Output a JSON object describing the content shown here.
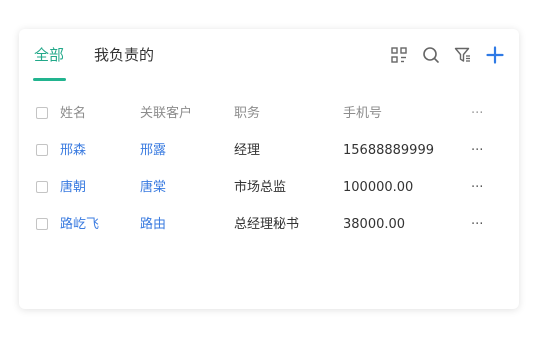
{
  "tabs": [
    {
      "label": "全部",
      "active": true
    },
    {
      "label": "我负责的",
      "active": false
    }
  ],
  "toolbar": {
    "icons": [
      "grid-view-icon",
      "search-icon",
      "filter-icon",
      "add-icon"
    ]
  },
  "colors": {
    "accent": "#22b48f",
    "link": "#3a7be0",
    "add": "#2f7ae5"
  },
  "table": {
    "columns": [
      "姓名",
      "关联客户",
      "职务",
      "手机号",
      "···"
    ],
    "rows": [
      {
        "name": "邢森",
        "customer": "邢露",
        "title": "经理",
        "phone": "15688889999",
        "more": "···"
      },
      {
        "name": "唐朝",
        "customer": "唐棠",
        "title": "市场总监",
        "phone": "100000.00",
        "more": "···"
      },
      {
        "name": "路屹飞",
        "customer": "路由",
        "title": "总经理秘书",
        "phone": "38000.00",
        "more": "···"
      }
    ]
  }
}
